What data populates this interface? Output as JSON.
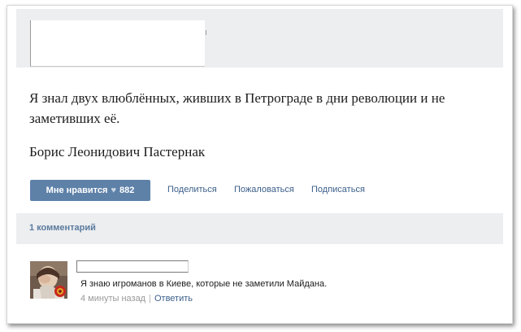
{
  "post": {
    "text": "Я знал двух влюблённых, живших в Петрограде в дни революции и не заметивших её.",
    "author": "Борис Леонидович Пастернак"
  },
  "actions": {
    "like_label": "Мне нравится",
    "like_count": "882",
    "share_label": "Поделиться",
    "report_label": "Пожаловаться",
    "subscribe_label": "Подписаться"
  },
  "comments": {
    "count_label": "1 комментарий",
    "items": [
      {
        "text": "Я знаю игроманов в Киеве, которые не заметили Майдана.",
        "time": "4 минуты назад",
        "separator": "|",
        "reply_label": "Ответить"
      }
    ]
  },
  "icons": {
    "like": "heart-icon",
    "avatar": "user-avatar"
  },
  "colors": {
    "accent": "#5e81a8",
    "link": "#3b5f8a",
    "panel": "#edeef0",
    "muted": "#999999"
  }
}
